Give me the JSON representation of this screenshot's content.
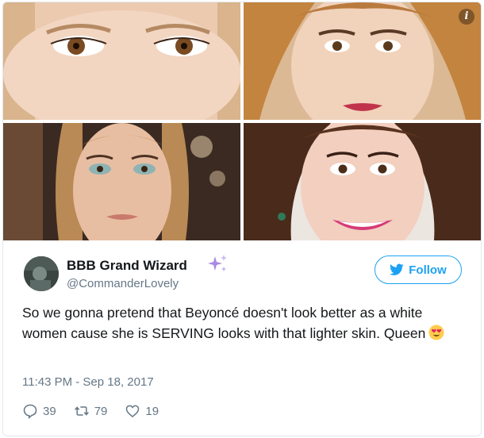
{
  "media": {
    "info_glyph": "i",
    "photos": [
      {
        "name": "photo-1",
        "bg": "#e9c9ae",
        "skin": "#f1d3bd",
        "hair": "#d8b38a"
      },
      {
        "name": "photo-2",
        "bg": "#c98a4a",
        "skin": "#efcdb3",
        "hair": "#c7874a"
      },
      {
        "name": "photo-3",
        "bg": "#3a2a20",
        "skin": "#e7bda0",
        "hair": "#b8864e"
      },
      {
        "name": "photo-4",
        "bg": "#efe9e4",
        "skin": "#f3d0bf",
        "hair": "#4a2a1a"
      }
    ]
  },
  "tweet": {
    "display_name": "BBB Grand Wizard",
    "handle": "@CommanderLovely",
    "follow_label": "Follow",
    "text": "So we gonna pretend that Beyoncé doesn't look better as a white women cause she is SERVING looks with that lighter skin. Queen",
    "timestamp": "11:43 PM - Sep 18, 2017",
    "replies": "39",
    "retweets": "79",
    "likes": "19",
    "icons": {
      "sparkle": "sparkle-icon",
      "bird": "twitter-bird-icon",
      "emoji": "heart-eyes-emoji-icon",
      "reply": "reply-icon",
      "retweet": "retweet-icon",
      "like": "heart-icon"
    },
    "colors": {
      "accent": "#1da1f2",
      "text": "#14171a",
      "muted": "#657786",
      "border": "#e1e8ed"
    }
  }
}
